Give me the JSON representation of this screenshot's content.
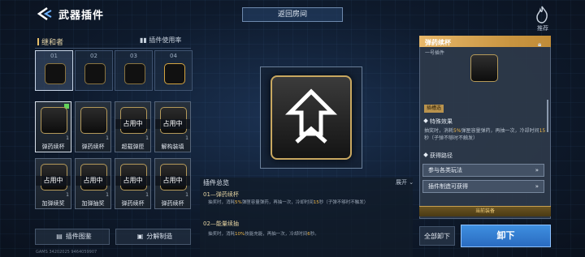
{
  "header": {
    "title": "武器插件",
    "return_room": "返回房间",
    "recommend": "推荐"
  },
  "left": {
    "tab_label": "继和者",
    "usage_label": "插件使用率",
    "wielders": [
      {
        "num": "01"
      },
      {
        "num": "02"
      },
      {
        "num": "03"
      },
      {
        "num": "04"
      }
    ],
    "cards": [
      {
        "name": "弹药续杯",
        "count": "1",
        "busy": ""
      },
      {
        "name": "弹药续杯",
        "count": "1",
        "busy": ""
      },
      {
        "name": "超载弹匣",
        "count": "1",
        "busy": "占用中"
      },
      {
        "name": "解构装填",
        "count": "1",
        "busy": "占用中"
      },
      {
        "name": "加弹续奖",
        "count": "1",
        "busy": "占用中"
      },
      {
        "name": "加弹抽奖",
        "count": "1",
        "busy": "占用中"
      },
      {
        "name": "弹药续杯",
        "count": "1",
        "busy": "占用中"
      },
      {
        "name": "弹药续杯",
        "count": "1",
        "busy": "占用中"
      }
    ],
    "catalog_button": "插件图鉴",
    "decompose_button": "分解制造",
    "footer_id": "GAMS 34202025 9464059907"
  },
  "summary": {
    "title": "插件总览",
    "expand": "展开",
    "item1_title": "01—弹药续杯",
    "item1_p1": "抽奖时，消耗",
    "item1_pct": "5%",
    "item1_p2": "弹匣容量弹药，再抽一次，冷却时间",
    "item1_sec": "15",
    "item1_p3": "秒（子弹不够时不触发）",
    "item2_title": "02—能量续抽",
    "item2_p1": "抽奖时，消耗",
    "item2_pct": "10%",
    "item2_p2": "技能充能，再抽一次，冷却时间",
    "item2_sec": "6",
    "item2_p3": "秒。"
  },
  "detail": {
    "name": "弹药续杯",
    "subtitle": "一号插件",
    "tag": "插槽选",
    "effect_title": "特殊效果",
    "effect_p1": "抽奖时，消耗",
    "effect_pct": "5%",
    "effect_p2": "弹匣容量弹药，再抽一次，冷却时间",
    "effect_sec": "15",
    "effect_p3": "秒（子弹不够时不触发）",
    "source_title": "获得路径",
    "source_1": "参与各类玩法",
    "source_2": "插件制造可获得",
    "equipped": "当前装备",
    "unload_all": "全部卸下",
    "unload": "卸下"
  }
}
